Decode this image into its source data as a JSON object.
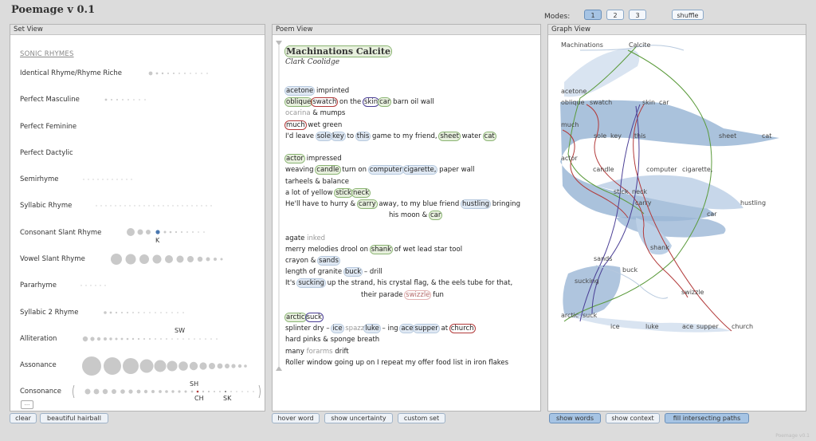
{
  "app": {
    "title": "Poemage v 0.1"
  },
  "modes": {
    "label": "Modes:",
    "buttons": [
      "1",
      "2",
      "3"
    ],
    "active": "1",
    "shuffle_label": "shuffle"
  },
  "set_view": {
    "header": "Set View",
    "heading": "SONIC RHYMES",
    "items": [
      {
        "label": "Identical Rhyme/Rhyme Riche"
      },
      {
        "label": "Perfect Masculine"
      },
      {
        "label": "Perfect Feminine"
      },
      {
        "label": "Perfect Dactylic"
      },
      {
        "label": "Semirhyme"
      },
      {
        "label": "Syllabic Rhyme"
      },
      {
        "label": "Consonant Slant Rhyme",
        "marker": "K"
      },
      {
        "label": "Vowel Slant Rhyme"
      },
      {
        "label": "Pararhyme"
      },
      {
        "label": "Syllabic 2 Rhyme"
      },
      {
        "label": "Alliteration",
        "marker": "SW"
      },
      {
        "label": "Assonance"
      },
      {
        "label": "Consonance",
        "markers": [
          "SH",
          "CH",
          "SK"
        ]
      }
    ],
    "more": "...",
    "buttons": {
      "clear": "clear",
      "hairball": "beautiful hairball"
    }
  },
  "poem_view": {
    "header": "Poem View",
    "title": "Machinations Calcite",
    "author": "Clark Coolidge",
    "lines": [
      {
        "words": [
          {
            "t": "acetone",
            "s": "blue"
          },
          {
            "t": " imprinted"
          }
        ]
      },
      {
        "words": [
          {
            "t": "oblique",
            "s": "greenbg"
          },
          {
            "t": "swatch",
            "s": "red"
          },
          {
            "t": " on the "
          },
          {
            "t": "skin",
            "s": "purple"
          },
          {
            "t": "car",
            "s": "greenbg"
          },
          {
            "t": " barn oil wall"
          }
        ]
      },
      {
        "words": [
          {
            "t": "ocarina",
            "s": "gray"
          },
          {
            "t": " & mumps"
          }
        ]
      },
      {
        "words": [
          {
            "t": "much",
            "s": "red"
          },
          {
            "t": " wet green"
          }
        ]
      },
      {
        "words": [
          {
            "t": "I'd leave "
          },
          {
            "t": "sole",
            "s": "blue"
          },
          {
            "t": "key",
            "s": "blue"
          },
          {
            "t": " to "
          },
          {
            "t": "this",
            "s": "blue"
          },
          {
            "t": " game to my friend, "
          },
          {
            "t": "sheet",
            "s": "greenbg"
          },
          {
            "t": " water "
          },
          {
            "t": "cat",
            "s": "greenbg"
          }
        ]
      },
      {
        "words": []
      },
      {
        "words": [
          {
            "t": "actor",
            "s": "greenbg"
          },
          {
            "t": " impressed"
          }
        ]
      },
      {
        "words": [
          {
            "t": "weaving "
          },
          {
            "t": "candle",
            "s": "greenbg"
          },
          {
            "t": " turn on "
          },
          {
            "t": "computer",
            "s": "blue"
          },
          {
            "t": "cigarette,",
            "s": "blue"
          },
          {
            "t": " paper wall"
          }
        ]
      },
      {
        "words": [
          {
            "t": "tarheels & balance"
          }
        ]
      },
      {
        "words": [
          {
            "t": "a lot of yellow "
          },
          {
            "t": "stick",
            "s": "greenbg"
          },
          {
            "t": "neck",
            "s": "greenbg"
          }
        ]
      },
      {
        "words": [
          {
            "t": "He'll have to hurry & "
          },
          {
            "t": "carry",
            "s": "greenbg"
          },
          {
            "t": " away, to my blue friend "
          },
          {
            "t": "hustling",
            "s": "blue"
          },
          {
            "t": " bringing"
          }
        ]
      },
      {
        "words": [
          {
            "t": "his moon & "
          },
          {
            "t": "car",
            "s": "greenbg"
          }
        ],
        "indent": true
      },
      {
        "words": []
      },
      {
        "words": [
          {
            "t": "agate "
          },
          {
            "t": "inked",
            "s": "gray"
          }
        ]
      },
      {
        "words": [
          {
            "t": "merry melodies drool on "
          },
          {
            "t": "shank",
            "s": "greenbg"
          },
          {
            "t": " of wet lead star tool"
          }
        ]
      },
      {
        "words": [
          {
            "t": "crayon & "
          },
          {
            "t": "sands",
            "s": "blue"
          }
        ]
      },
      {
        "words": [
          {
            "t": "length of granite "
          },
          {
            "t": "buck",
            "s": "blue"
          },
          {
            "t": " – drill"
          }
        ]
      },
      {
        "words": [
          {
            "t": "It's "
          },
          {
            "t": "sucking",
            "s": "blue"
          },
          {
            "t": " up the strand, his crystal flag, & the eels tube for that,"
          }
        ]
      },
      {
        "words": [
          {
            "t": "their parade "
          },
          {
            "t": "swizzle",
            "s": "pink"
          },
          {
            "t": " fun"
          }
        ],
        "indent2": true
      },
      {
        "words": []
      },
      {
        "words": [
          {
            "t": "arctic",
            "s": "greenbg"
          },
          {
            "t": "suck",
            "s": "purple"
          }
        ]
      },
      {
        "words": [
          {
            "t": "splinter dry – "
          },
          {
            "t": "ice",
            "s": "blue"
          },
          {
            "t": " spazz",
            "s": "gray"
          },
          {
            "t": "luke",
            "s": "blue"
          },
          {
            "t": " – ing "
          },
          {
            "t": "ace",
            "s": "blue"
          },
          {
            "t": "supper",
            "s": "blue"
          },
          {
            "t": " at "
          },
          {
            "t": "church",
            "s": "red"
          }
        ]
      },
      {
        "words": [
          {
            "t": "hard pinks & sponge breath"
          }
        ]
      },
      {
        "words": [
          {
            "t": "many "
          },
          {
            "t": "forarms",
            "s": "gray"
          },
          {
            "t": " drift"
          }
        ]
      },
      {
        "words": [
          {
            "t": "Roller window going up on I repeat my offer food list in iron flakes"
          }
        ]
      }
    ],
    "buttons": {
      "hover": "hover word",
      "uncertainty": "show uncertainty",
      "custom": "custom set"
    }
  },
  "graph_view": {
    "header": "Graph View",
    "words": [
      "Machinations",
      "Calcite",
      "acetone",
      "oblique",
      "swatch",
      "skin",
      "car",
      "much",
      "sole",
      "key",
      "this",
      "sheet",
      "cat",
      "actor",
      "candle",
      "computer",
      "cigarette,",
      "stick",
      "neck",
      "carry",
      "hustling",
      "car",
      "shank",
      "sands",
      "buck",
      "sucking",
      "swizzle",
      "arctic",
      "suck",
      "ice",
      "luke",
      "ace",
      "supper",
      "church"
    ],
    "buttons": {
      "words": "show words",
      "context": "show context",
      "fill": "fill intersecting paths"
    },
    "colors": {
      "band": "#9bb7d6",
      "band_light": "#d9e4f1",
      "green": "#5a9a3a",
      "red": "#b23a3a",
      "purple": "#4a3e95"
    }
  },
  "footer": "Poemage v0.1"
}
